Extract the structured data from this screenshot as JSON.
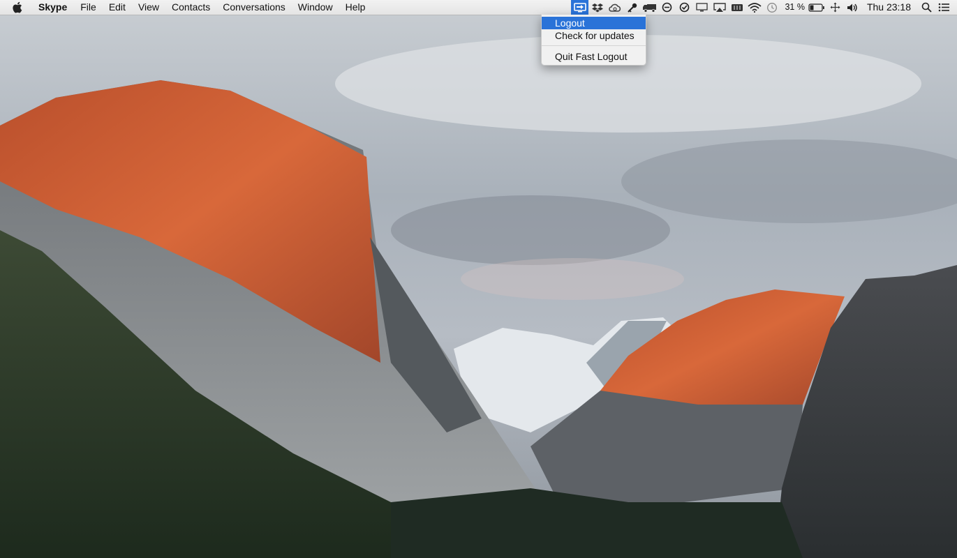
{
  "menubar": {
    "apple_icon": "apple-logo-icon",
    "app_name": "Skype",
    "menus": [
      "File",
      "Edit",
      "View",
      "Contacts",
      "Conversations",
      "Window",
      "Help"
    ],
    "status_icons": [
      "fast-logout-icon",
      "dropbox-icon",
      "creative-cloud-icon",
      "keychain-icon",
      "delivery-truck-icon",
      "no-entry-icon",
      "checkmark-circle-icon",
      "display-icon",
      "airplay-icon",
      "battery-grid-icon",
      "wifi-icon",
      "time-machine-icon"
    ],
    "battery_percent": "31 %",
    "battery_level": 0.31,
    "clock": "Thu 23:18",
    "trailing_icons": [
      "move-arrows-icon",
      "volume-icon",
      "spotlight-search-icon",
      "notification-center-icon"
    ]
  },
  "dropdown": {
    "items": [
      "Logout",
      "Check for updates"
    ],
    "quit_label": "Quit Fast Logout",
    "highlighted_item": "Logout"
  },
  "colors": {
    "highlight": "#2a73d8",
    "menubar": "#ececec"
  }
}
